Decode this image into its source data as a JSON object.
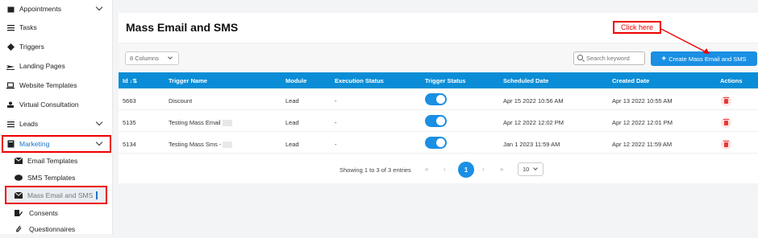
{
  "sidebar": {
    "items": [
      {
        "label": "Appointments",
        "icon": "calendar-icon"
      },
      {
        "label": "Tasks",
        "icon": "list-icon"
      },
      {
        "label": "Triggers",
        "icon": "diamond-icon"
      },
      {
        "label": "Landing Pages",
        "icon": "plane-icon"
      },
      {
        "label": "Website Templates",
        "icon": "laptop-icon"
      },
      {
        "label": "Virtual Consultation",
        "icon": "user-icon"
      },
      {
        "label": "Leads",
        "icon": "list-icon"
      },
      {
        "label": "Marketing",
        "icon": "book-icon"
      }
    ],
    "sub_items": [
      {
        "label": "Email Templates",
        "icon": "mail-icon"
      },
      {
        "label": "SMS Templates",
        "icon": "chat-icon"
      },
      {
        "label": "Mass Email and SMS",
        "icon": "mail-icon"
      },
      {
        "label": "Consents",
        "icon": "edit-icon"
      },
      {
        "label": "Questionnaires",
        "icon": "clip-icon"
      }
    ]
  },
  "page": {
    "title": "Mass Email and SMS",
    "columns_label": "8 Columns",
    "search_placeholder": "Search keyword",
    "create_label": "Create Mass Email and SMS",
    "callout": "Click here"
  },
  "table": {
    "headers": [
      "Id",
      "Trigger Name",
      "Module",
      "Execution Status",
      "Trigger Status",
      "Scheduled Date",
      "Created Date",
      "Actions"
    ],
    "rows": [
      {
        "id": "5663",
        "name": "Discount",
        "module": "Lead",
        "exec": "-",
        "scheduled": "Apr 15 2022 10:56 AM",
        "created": "Apr 13 2022 10:55 AM"
      },
      {
        "id": "5135",
        "name": "Testing Mass Email",
        "module": "Lead",
        "exec": "-",
        "scheduled": "Apr 12 2022 12:02 PM",
        "created": "Apr 12 2022 12:01 PM"
      },
      {
        "id": "5134",
        "name": "Testing Mass Sms -",
        "module": "Lead",
        "exec": "-",
        "scheduled": "Jan 1 2023 11:59 AM",
        "created": "Apr 12 2022 11:59 AM"
      }
    ]
  },
  "pagination": {
    "info": "Showing 1 to 3 of 3 entries",
    "first": "«",
    "prev": "‹",
    "current": "1",
    "next": "›",
    "last": "»",
    "per_page": "10"
  },
  "colors": {
    "accent": "#1a8fe3",
    "header": "#0a8dd6",
    "annotation": "#e00000"
  }
}
